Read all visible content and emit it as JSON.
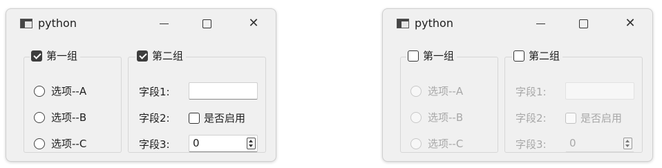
{
  "windows": [
    {
      "title": "python",
      "close_glyph": "✕",
      "group1": {
        "title": "第一组",
        "checked": true,
        "options": [
          "选项--A",
          "选项--B",
          "选项--C"
        ]
      },
      "group2": {
        "title": "第二组",
        "checked": true,
        "field1_label": "字段1:",
        "field1_value": "",
        "field2_label": "字段2:",
        "field2_checkbox_label": "是否启用",
        "field3_label": "字段3:",
        "field3_value": "0"
      },
      "enabled": true
    },
    {
      "title": "python",
      "close_glyph": "✕",
      "group1": {
        "title": "第一组",
        "checked": false,
        "options": [
          "选项--A",
          "选项--B",
          "选项--C"
        ]
      },
      "group2": {
        "title": "第二组",
        "checked": false,
        "field1_label": "字段1:",
        "field1_value": "",
        "field2_label": "字段2:",
        "field2_checkbox_label": "是否启用",
        "field3_label": "字段3:",
        "field3_value": "0"
      },
      "enabled": false
    }
  ],
  "icons": [
    "app-window-icon",
    "minimize-icon",
    "maximize-icon",
    "close-icon",
    "spin-up-icon",
    "spin-down-icon"
  ]
}
